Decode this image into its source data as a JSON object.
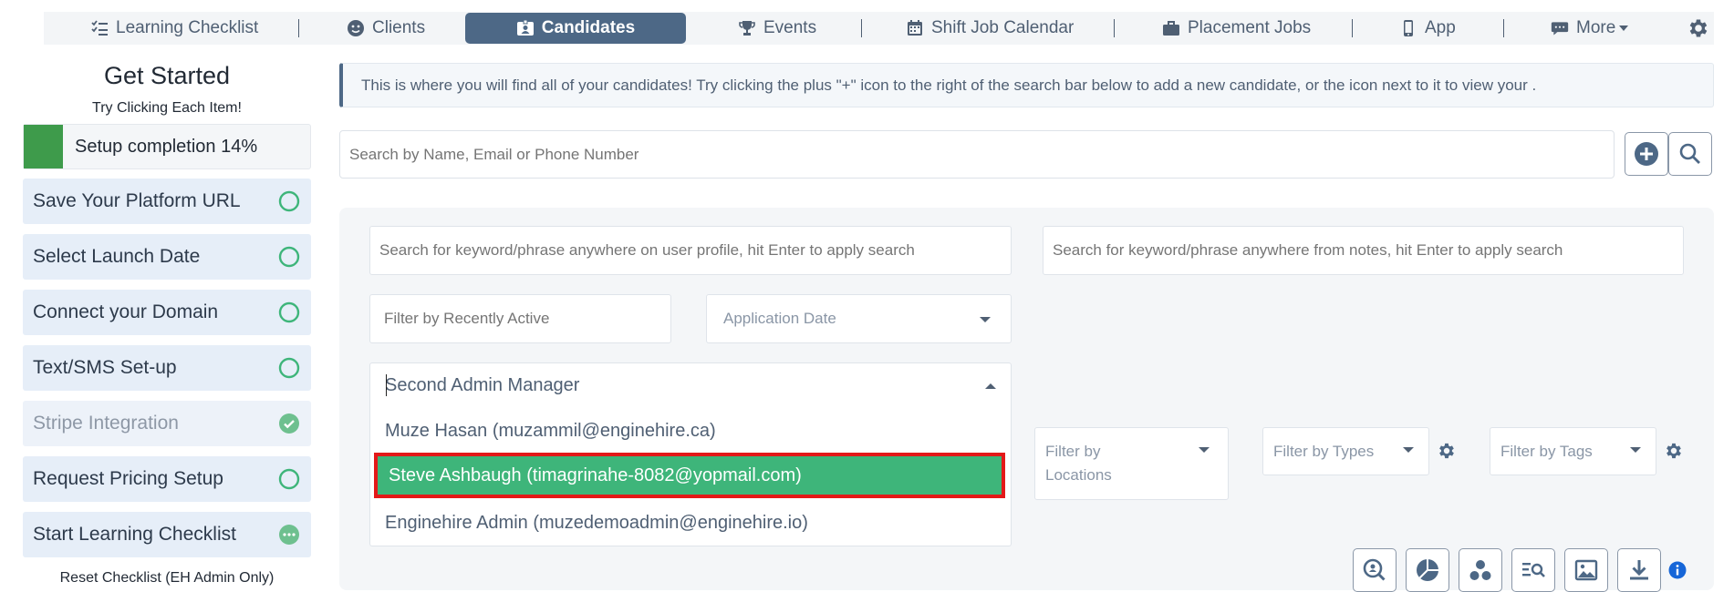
{
  "nav": {
    "items": [
      {
        "label": "Learning Checklist",
        "icon": "checklist-icon"
      },
      {
        "label": "Clients",
        "icon": "face-icon"
      },
      {
        "label": "Candidates",
        "icon": "id-card-icon",
        "active": true
      },
      {
        "label": "Events",
        "icon": "trophy-icon"
      },
      {
        "label": "Shift Job Calendar",
        "icon": "calendar-icon"
      },
      {
        "label": "Placement Jobs",
        "icon": "briefcase-icon"
      },
      {
        "label": "App",
        "icon": "phone-icon"
      },
      {
        "label": "More",
        "icon": "chat-icon"
      }
    ],
    "settings_icon": "gear-icon",
    "colors": {
      "bar": "#f3f5f7",
      "active": "#4d6886",
      "text": "#4f5f73"
    }
  },
  "sidebar": {
    "title": "Get Started",
    "subtitle": "Try Clicking Each Item!",
    "progress": {
      "label": "Setup completion 14%",
      "percent": 14
    },
    "items": [
      {
        "label": "Save Your Platform URL",
        "status": "pending"
      },
      {
        "label": "Select Launch Date",
        "status": "pending"
      },
      {
        "label": "Connect your Domain",
        "status": "pending"
      },
      {
        "label": "Text/SMS Set-up",
        "status": "pending"
      },
      {
        "label": "Stripe Integration",
        "status": "complete"
      },
      {
        "label": "Request Pricing Setup",
        "status": "pending"
      },
      {
        "label": "Start Learning Checklist",
        "status": "in-progress"
      }
    ],
    "reset_label": "Reset Checklist (EH Admin Only)",
    "colors": {
      "progress": "#3e9b4b",
      "item_bg": "#e6eef8",
      "status": "#3eb57a"
    }
  },
  "main": {
    "info_text": "This is where you will find all of your candidates! Try clicking the plus \"+\" icon to the right of the search bar below to add a new candidate, or the icon next to it to view your .",
    "search_placeholder": "Search by Name, Email or Phone Number",
    "filters": {
      "profile_search_placeholder": "Search for keyword/phrase anywhere on user profile, hit Enter to apply search",
      "notes_search_placeholder": "Search for keyword/phrase anywhere from notes, hit Enter to apply search",
      "recently_active_placeholder": "Filter by Recently Active",
      "application_date": "Application Date",
      "locations": "Filter by Locations",
      "types": "Filter by Types",
      "tags": "Filter by Tags"
    },
    "manager_dropdown": {
      "value": "Second Admin Manager",
      "options": [
        {
          "label": "Muze Hasan (muzammil@enginehire.ca)",
          "highlighted": false
        },
        {
          "label": "Steve Ashbaugh (timagrinahe-8082@yopmail.com)",
          "highlighted": true
        },
        {
          "label": "Enginehire Admin (muzedemoadmin@enginehire.io)",
          "highlighted": false
        }
      ],
      "colors": {
        "highlight": "#3eb57a",
        "outline": "#e31818"
      }
    },
    "toolbar_icons": [
      "search-profile-icon",
      "pie-chart-icon",
      "cluster-icon",
      "list-search-icon",
      "image-icon",
      "download-icon",
      "info-icon"
    ]
  }
}
